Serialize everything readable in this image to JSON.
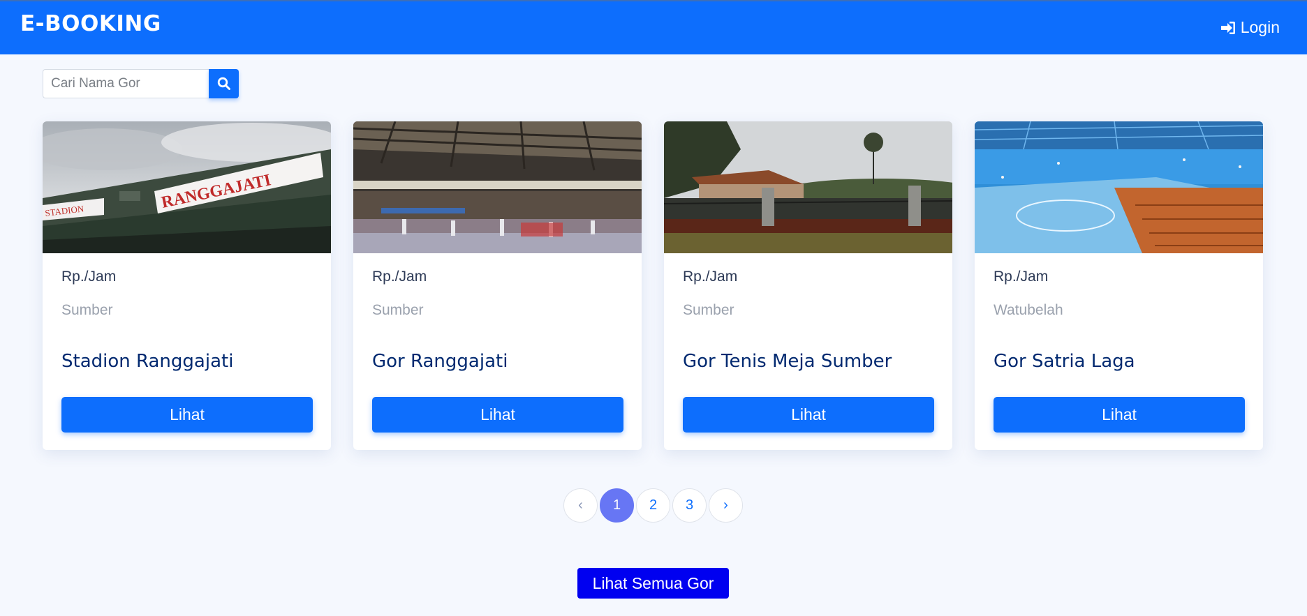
{
  "navbar": {
    "brand": "E-BOOKING",
    "login_label": "Login",
    "login_icon": "sign-in-icon",
    "color": "#0d6efd"
  },
  "search": {
    "placeholder": "Cari Nama Gor",
    "icon": "search-icon"
  },
  "cards": [
    {
      "price": "Rp./Jam",
      "location": "Sumber",
      "name": "Stadion Ranggajati",
      "button": "Lihat",
      "image_banner_text": "RANGGAJATI",
      "image_sign_text": "STADION"
    },
    {
      "price": "Rp./Jam",
      "location": "Sumber",
      "name": "Gor Ranggajati",
      "button": "Lihat"
    },
    {
      "price": "Rp./Jam",
      "location": "Sumber",
      "name": "Gor Tenis Meja Sumber",
      "button": "Lihat"
    },
    {
      "price": "Rp./Jam",
      "location": "Watubelah",
      "name": "Gor Satria Laga",
      "button": "Lihat"
    }
  ],
  "pagination": {
    "prev": "‹",
    "pages": [
      "1",
      "2",
      "3"
    ],
    "active": "1",
    "next": "›"
  },
  "footer": {
    "all_button": "Lihat Semua Gor",
    "all_button_color": "#0000f0"
  }
}
